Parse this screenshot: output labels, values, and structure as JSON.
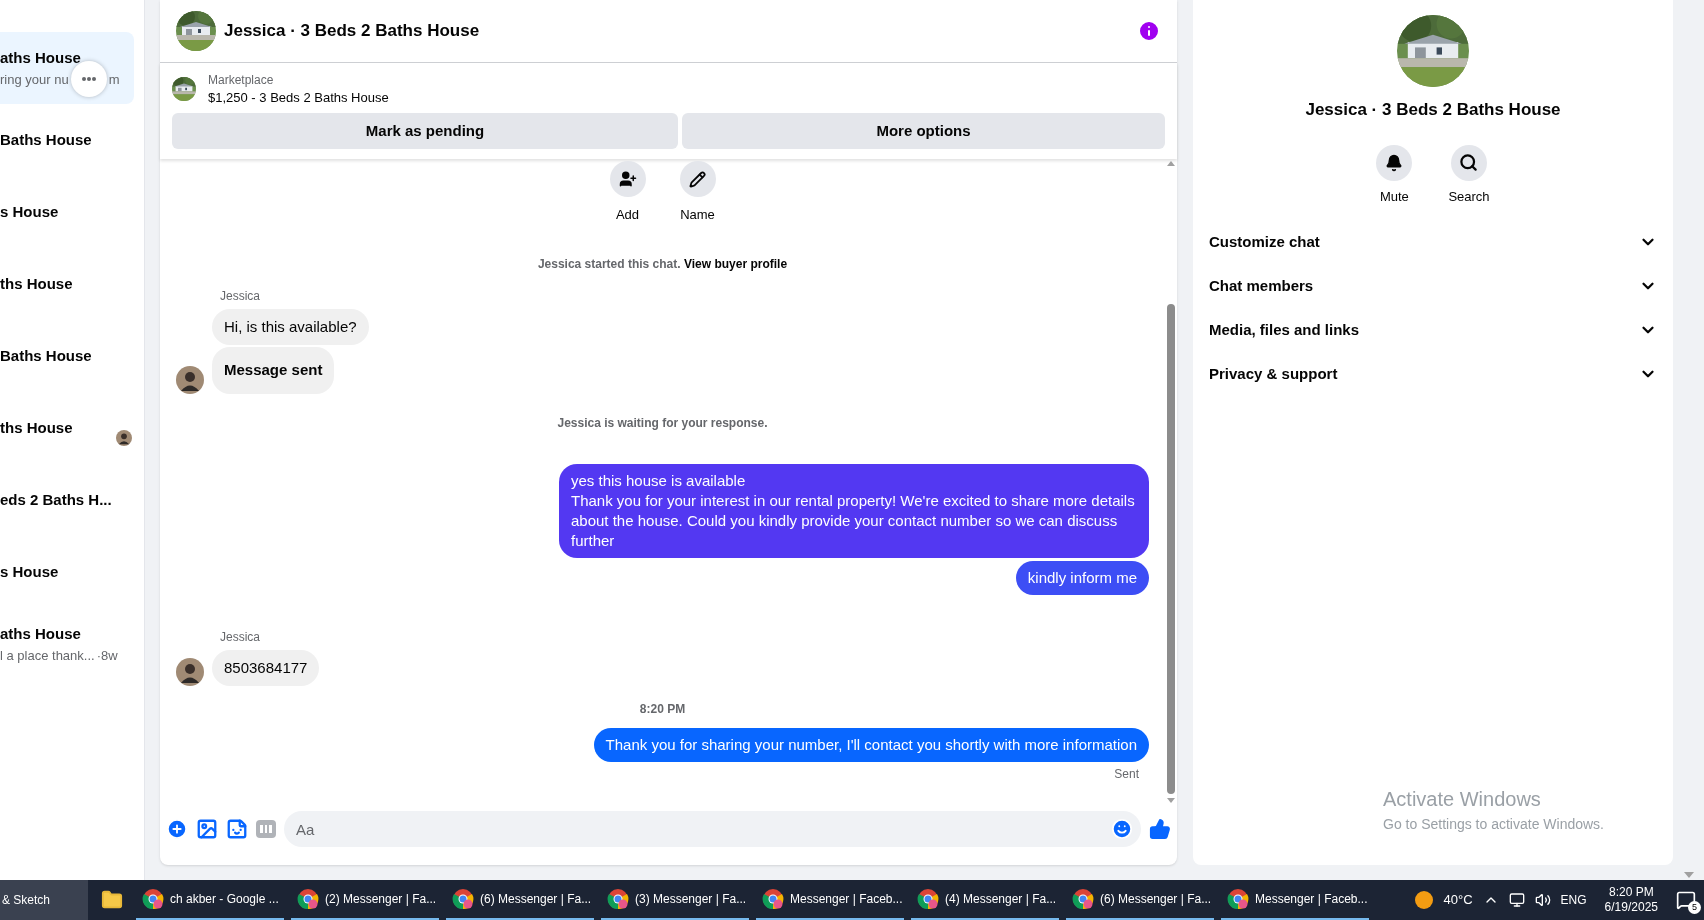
{
  "sidebar": {
    "items": [
      {
        "title": "aths House",
        "preview_start": "ring your nu",
        "preview_end": "m",
        "selected": true,
        "more": true
      },
      {
        "title": "Baths House",
        "selected": false
      },
      {
        "title": "s House",
        "selected": false
      },
      {
        "title": "ths House",
        "selected": false
      },
      {
        "title": "Baths House",
        "selected": false
      },
      {
        "title": "ths House",
        "selected": false,
        "seen_avatar": true
      },
      {
        "title": "eds 2 Baths H...",
        "selected": false
      },
      {
        "title": "s House",
        "selected": false
      },
      {
        "title": "aths House",
        "preview_start": "l a place thank...",
        "time": "·8w",
        "selected": false
      }
    ]
  },
  "chat": {
    "title": "Jessica · 3 Beds 2 Baths House",
    "listing": {
      "source": "Marketplace",
      "name": "$1,250 - 3 Beds 2 Baths House"
    },
    "buttons": [
      "Mark as pending",
      "More options"
    ],
    "actions": [
      {
        "kind": "add",
        "label": "Add"
      },
      {
        "kind": "edit",
        "label": "Name"
      }
    ],
    "messages": [
      {
        "kind": "event",
        "text": "Jessica started this chat.",
        "link": "View buyer profile"
      },
      {
        "kind": "incoming",
        "sender": "Jessica",
        "bubbles": [
          {
            "text": "Hi, is this available?",
            "bold": false
          },
          {
            "text": "Message sent",
            "bold": true
          }
        ]
      },
      {
        "kind": "event",
        "text": "Jessica is waiting for your response."
      },
      {
        "kind": "outgoing",
        "bubbles": [
          {
            "text": "yes this house is available\nThank you for your interest in our rental property! We're excited to share more details about the house. Could you kindly provide your contact number so we can discuss further",
            "color": "#5338f2"
          },
          {
            "text": "kindly inform me",
            "color": "#3d4ef5"
          }
        ]
      },
      {
        "kind": "incoming",
        "sender": "Jessica",
        "bubbles": [
          {
            "text": "8503684177",
            "bold": false
          }
        ]
      },
      {
        "kind": "time",
        "text": "8:20 PM"
      },
      {
        "kind": "outgoing",
        "bubbles": [
          {
            "text": "Thank you for sharing your number, I'll contact you shortly with more information",
            "color": "#0866ff"
          }
        ],
        "status": "Sent"
      }
    ],
    "composer": {
      "placeholder": "Aa"
    }
  },
  "details": {
    "title": "Jessica · 3 Beds 2 Baths House",
    "actions": [
      {
        "kind": "mute",
        "label": "Mute"
      },
      {
        "kind": "search",
        "label": "Search"
      }
    ],
    "sections": [
      {
        "label": "Customize chat",
        "expanded": false
      },
      {
        "label": "Chat members",
        "expanded": false
      },
      {
        "label": "Media, files and links",
        "expanded": false
      },
      {
        "label": "Privacy & support",
        "expanded": false
      }
    ]
  },
  "activation": {
    "title": "Activate Windows",
    "text": "Go to Settings to activate Windows."
  },
  "taskbar": {
    "items": [
      {
        "kind": "text",
        "label": "& Sketch",
        "selected": false
      },
      {
        "kind": "folder",
        "selected": false
      },
      {
        "kind": "browser",
        "label": "ch akber - Google ...",
        "selected": true
      },
      {
        "kind": "browser",
        "label": "(2) Messenger | Fa...",
        "selected": true
      },
      {
        "kind": "browser",
        "label": "(6) Messenger | Fa...",
        "selected": true
      },
      {
        "kind": "browser",
        "label": "(3) Messenger | Fa...",
        "selected": true
      },
      {
        "kind": "browser",
        "label": "Messenger | Faceb...",
        "selected": true
      },
      {
        "kind": "browser",
        "label": "(4) Messenger | Fa...",
        "selected": true
      },
      {
        "kind": "browser",
        "label": "(6) Messenger | Fa...",
        "selected": true
      },
      {
        "kind": "browser",
        "label": "Messenger | Faceb...",
        "selected": true
      }
    ],
    "weather": "40°C",
    "language": "ENG",
    "time": "8:20 PM",
    "date": "6/19/2025",
    "notifications": "5"
  }
}
